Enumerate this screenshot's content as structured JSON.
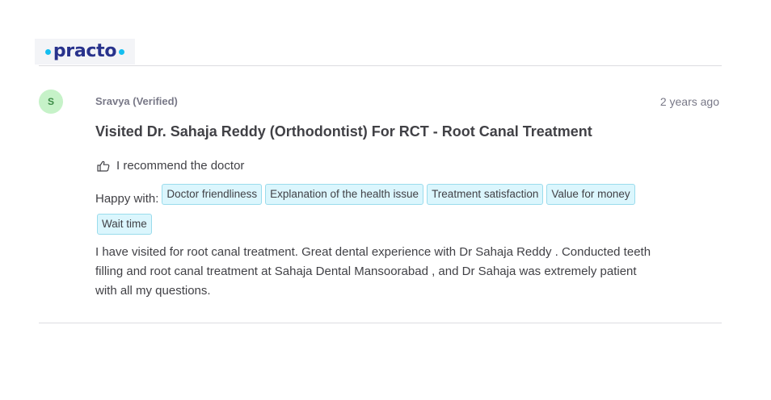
{
  "brand": {
    "logo_text": "practo",
    "accent": "#14bef0",
    "brand_color": "#28328c"
  },
  "review": {
    "avatar_initial": "S",
    "reviewer": "Sravya (Verified)",
    "time_ago": "2 years ago",
    "title": "Visited Dr. Sahaja Reddy (Orthodontist) For RCT - Root Canal Treatment",
    "recommend_text": "I recommend the doctor",
    "recommend_icon": "thumbs-up-icon",
    "happy_label": "Happy with:",
    "happy_tags": [
      "Doctor friendliness",
      "Explanation of the health issue",
      "Treatment satisfaction",
      "Value for money",
      "Wait time"
    ],
    "body": "I have visited for root canal treatment. Great dental experience with Dr Sahaja Reddy . Conducted teeth filling and root canal treatment at Sahaja Dental Mansoorabad , and Dr Sahaja was extremely patient with all my questions."
  }
}
